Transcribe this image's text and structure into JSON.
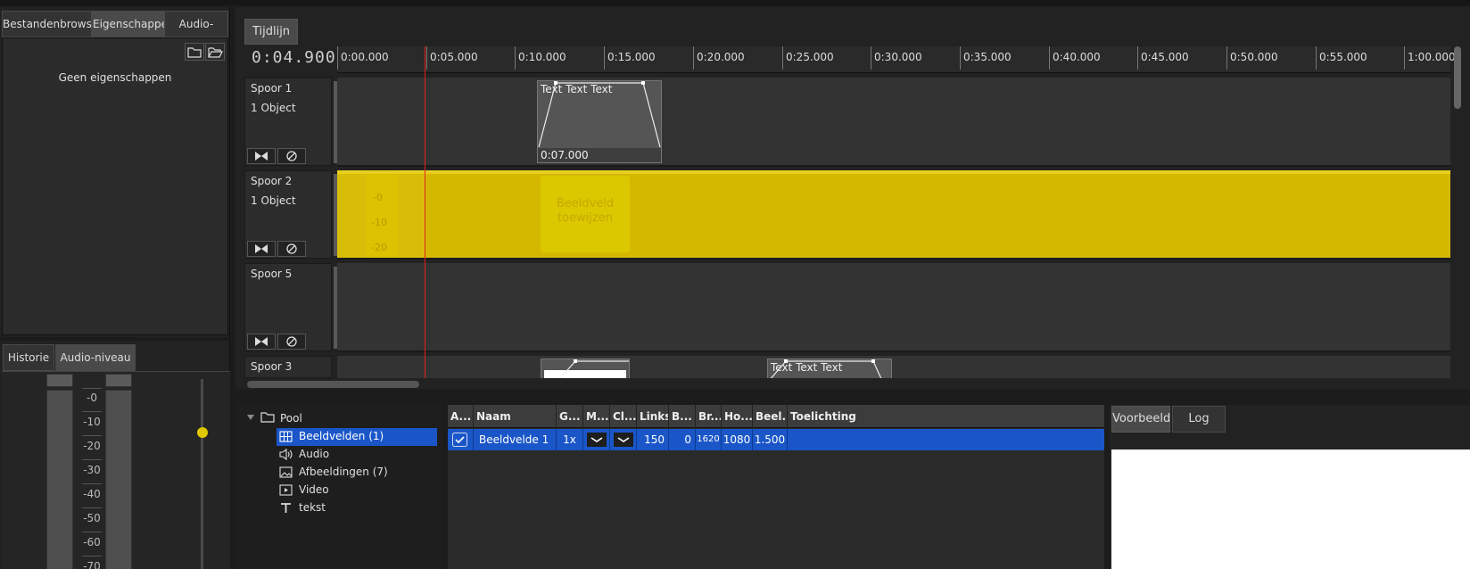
{
  "left_panel": {
    "tabs": [
      "Bestandenbrowser",
      "Eigenschappen",
      "Audio-plugins"
    ],
    "empty_text": "Geen eigenschappen"
  },
  "audio_panel": {
    "tabs": [
      "Historie",
      "Audio-niveau"
    ],
    "scale": [
      "-0",
      "-10",
      "-20",
      "-30",
      "-40",
      "-50",
      "-60",
      "-70"
    ],
    "slider_level": 0.28,
    "slider_color": "#e0c800"
  },
  "timeline": {
    "tab": "Tijdlijn",
    "timecode": "0:04.900",
    "ruler": [
      "0:00.000",
      "0:05.000",
      "0:10.000",
      "0:15.000",
      "0:20.000",
      "0:25.000",
      "0:30.000",
      "0:35.000",
      "0:40.000",
      "0:45.000",
      "0:50.000",
      "0:55.000",
      "1:00.000"
    ],
    "tracks": [
      {
        "name": "Spoor 1",
        "objects": "1 Object"
      },
      {
        "name": "Spoor 2",
        "objects": "1 Object"
      },
      {
        "name": "Spoor 5",
        "objects": ""
      },
      {
        "name": "Spoor 3",
        "objects": ""
      }
    ],
    "clip1": {
      "title": "Text Text Text",
      "duration": "0:07.000"
    },
    "clip2": {
      "scale": [
        "-0",
        "-10",
        "-20"
      ],
      "overlay": "Beeldveld toewijzen",
      "color": "#d4b800"
    },
    "clip3": {
      "title": "Text Text Text"
    }
  },
  "pool": {
    "root": "Pool",
    "items": [
      "Beeldvelden (1)",
      "Audio",
      "Afbeeldingen (7)",
      "Video",
      "tekst"
    ]
  },
  "grid": {
    "headers": [
      "A...",
      "Naam",
      "G...",
      "M...",
      "Cl...",
      "Links",
      "B...",
      "Br...",
      "Ho...",
      "Beel...",
      "Toelichting"
    ],
    "row": {
      "naam": "Beeldvelde 1",
      "g": "1x",
      "links": "150",
      "b": "0",
      "br": "1620",
      "ho": "1080",
      "beel": "1.500",
      "toelichting": ""
    }
  },
  "preview": {
    "tabs": [
      "Voorbeeld",
      "Log"
    ]
  },
  "colors": {
    "selection": "#1a56c8",
    "playhead": "#e02020"
  }
}
